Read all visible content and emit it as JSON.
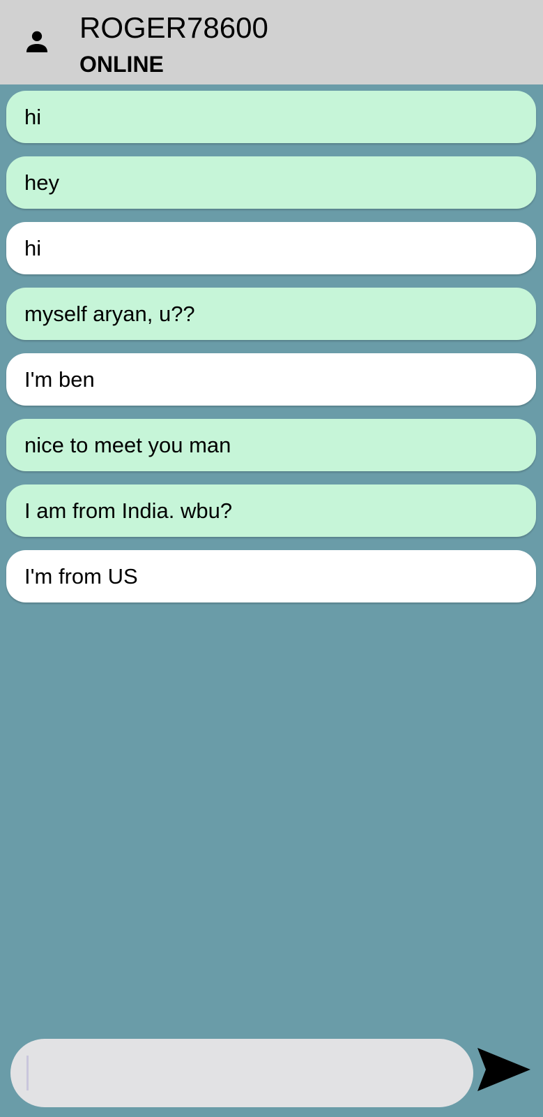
{
  "header": {
    "username": "ROGER78600",
    "status": "ONLINE"
  },
  "messages": [
    {
      "text": "hi",
      "kind": "sent"
    },
    {
      "text": "hey",
      "kind": "sent"
    },
    {
      "text": "hi",
      "kind": "received"
    },
    {
      "text": "myself aryan, u??",
      "kind": "sent"
    },
    {
      "text": "I'm ben",
      "kind": "received"
    },
    {
      "text": "nice to meet you man",
      "kind": "sent"
    },
    {
      "text": "I am from India. wbu?",
      "kind": "sent"
    },
    {
      "text": "I'm from US",
      "kind": "received"
    }
  ],
  "composer": {
    "value": "",
    "placeholder": ""
  },
  "icons": {
    "avatar": "person-icon",
    "send": "send-icon"
  },
  "colors": {
    "background": "#6a9ca8",
    "header": "#d1d1d1",
    "sent_bubble": "#c6f5d8",
    "received_bubble": "#ffffff",
    "composer": "#e2e2e4"
  }
}
